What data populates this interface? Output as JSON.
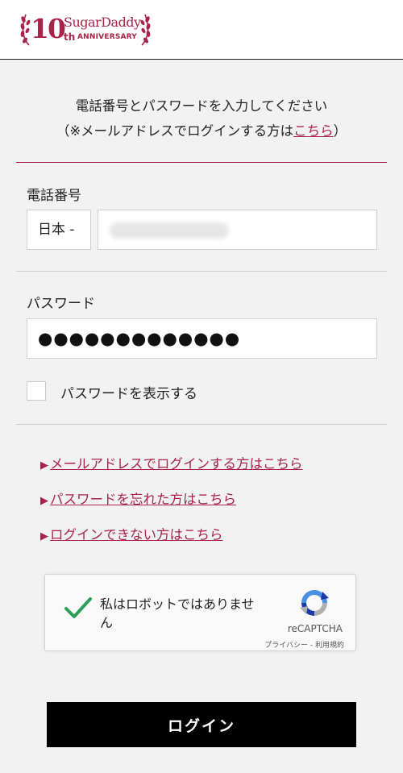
{
  "header": {
    "logo": {
      "number": "10",
      "brand": "SugarDaddy",
      "suffix": "th",
      "anniversary": "ANNIVERSARY"
    }
  },
  "intro": {
    "line1": "電話番号とパスワードを入力してください",
    "line2_prefix": "（※メールアドレスでログインする方は",
    "line2_link": "こちら",
    "line2_suffix": "）"
  },
  "form": {
    "phone_label": "電話番号",
    "country_value": "日本 -",
    "phone_value": "",
    "password_label": "パスワード",
    "password_masked": "●●●●●●●●●●●●●",
    "show_password_label": "パスワードを表示する"
  },
  "links": [
    {
      "marker": "▶",
      "label": "メールアドレスでログインする方はこちら"
    },
    {
      "marker": "▶",
      "label": "パスワードを忘れた方はこちら"
    },
    {
      "marker": "▶",
      "label": "ログインできない方はこちら"
    }
  ],
  "recaptcha": {
    "label": "私はロボットではありません",
    "brand": "reCAPTCHA",
    "footer": "プライバシー - 利用規約"
  },
  "login_button": "ログイン",
  "colors": {
    "accent": "#a8234a",
    "button": "#000000",
    "background": "#f2f2f2",
    "check_green": "#2e9e5b"
  }
}
